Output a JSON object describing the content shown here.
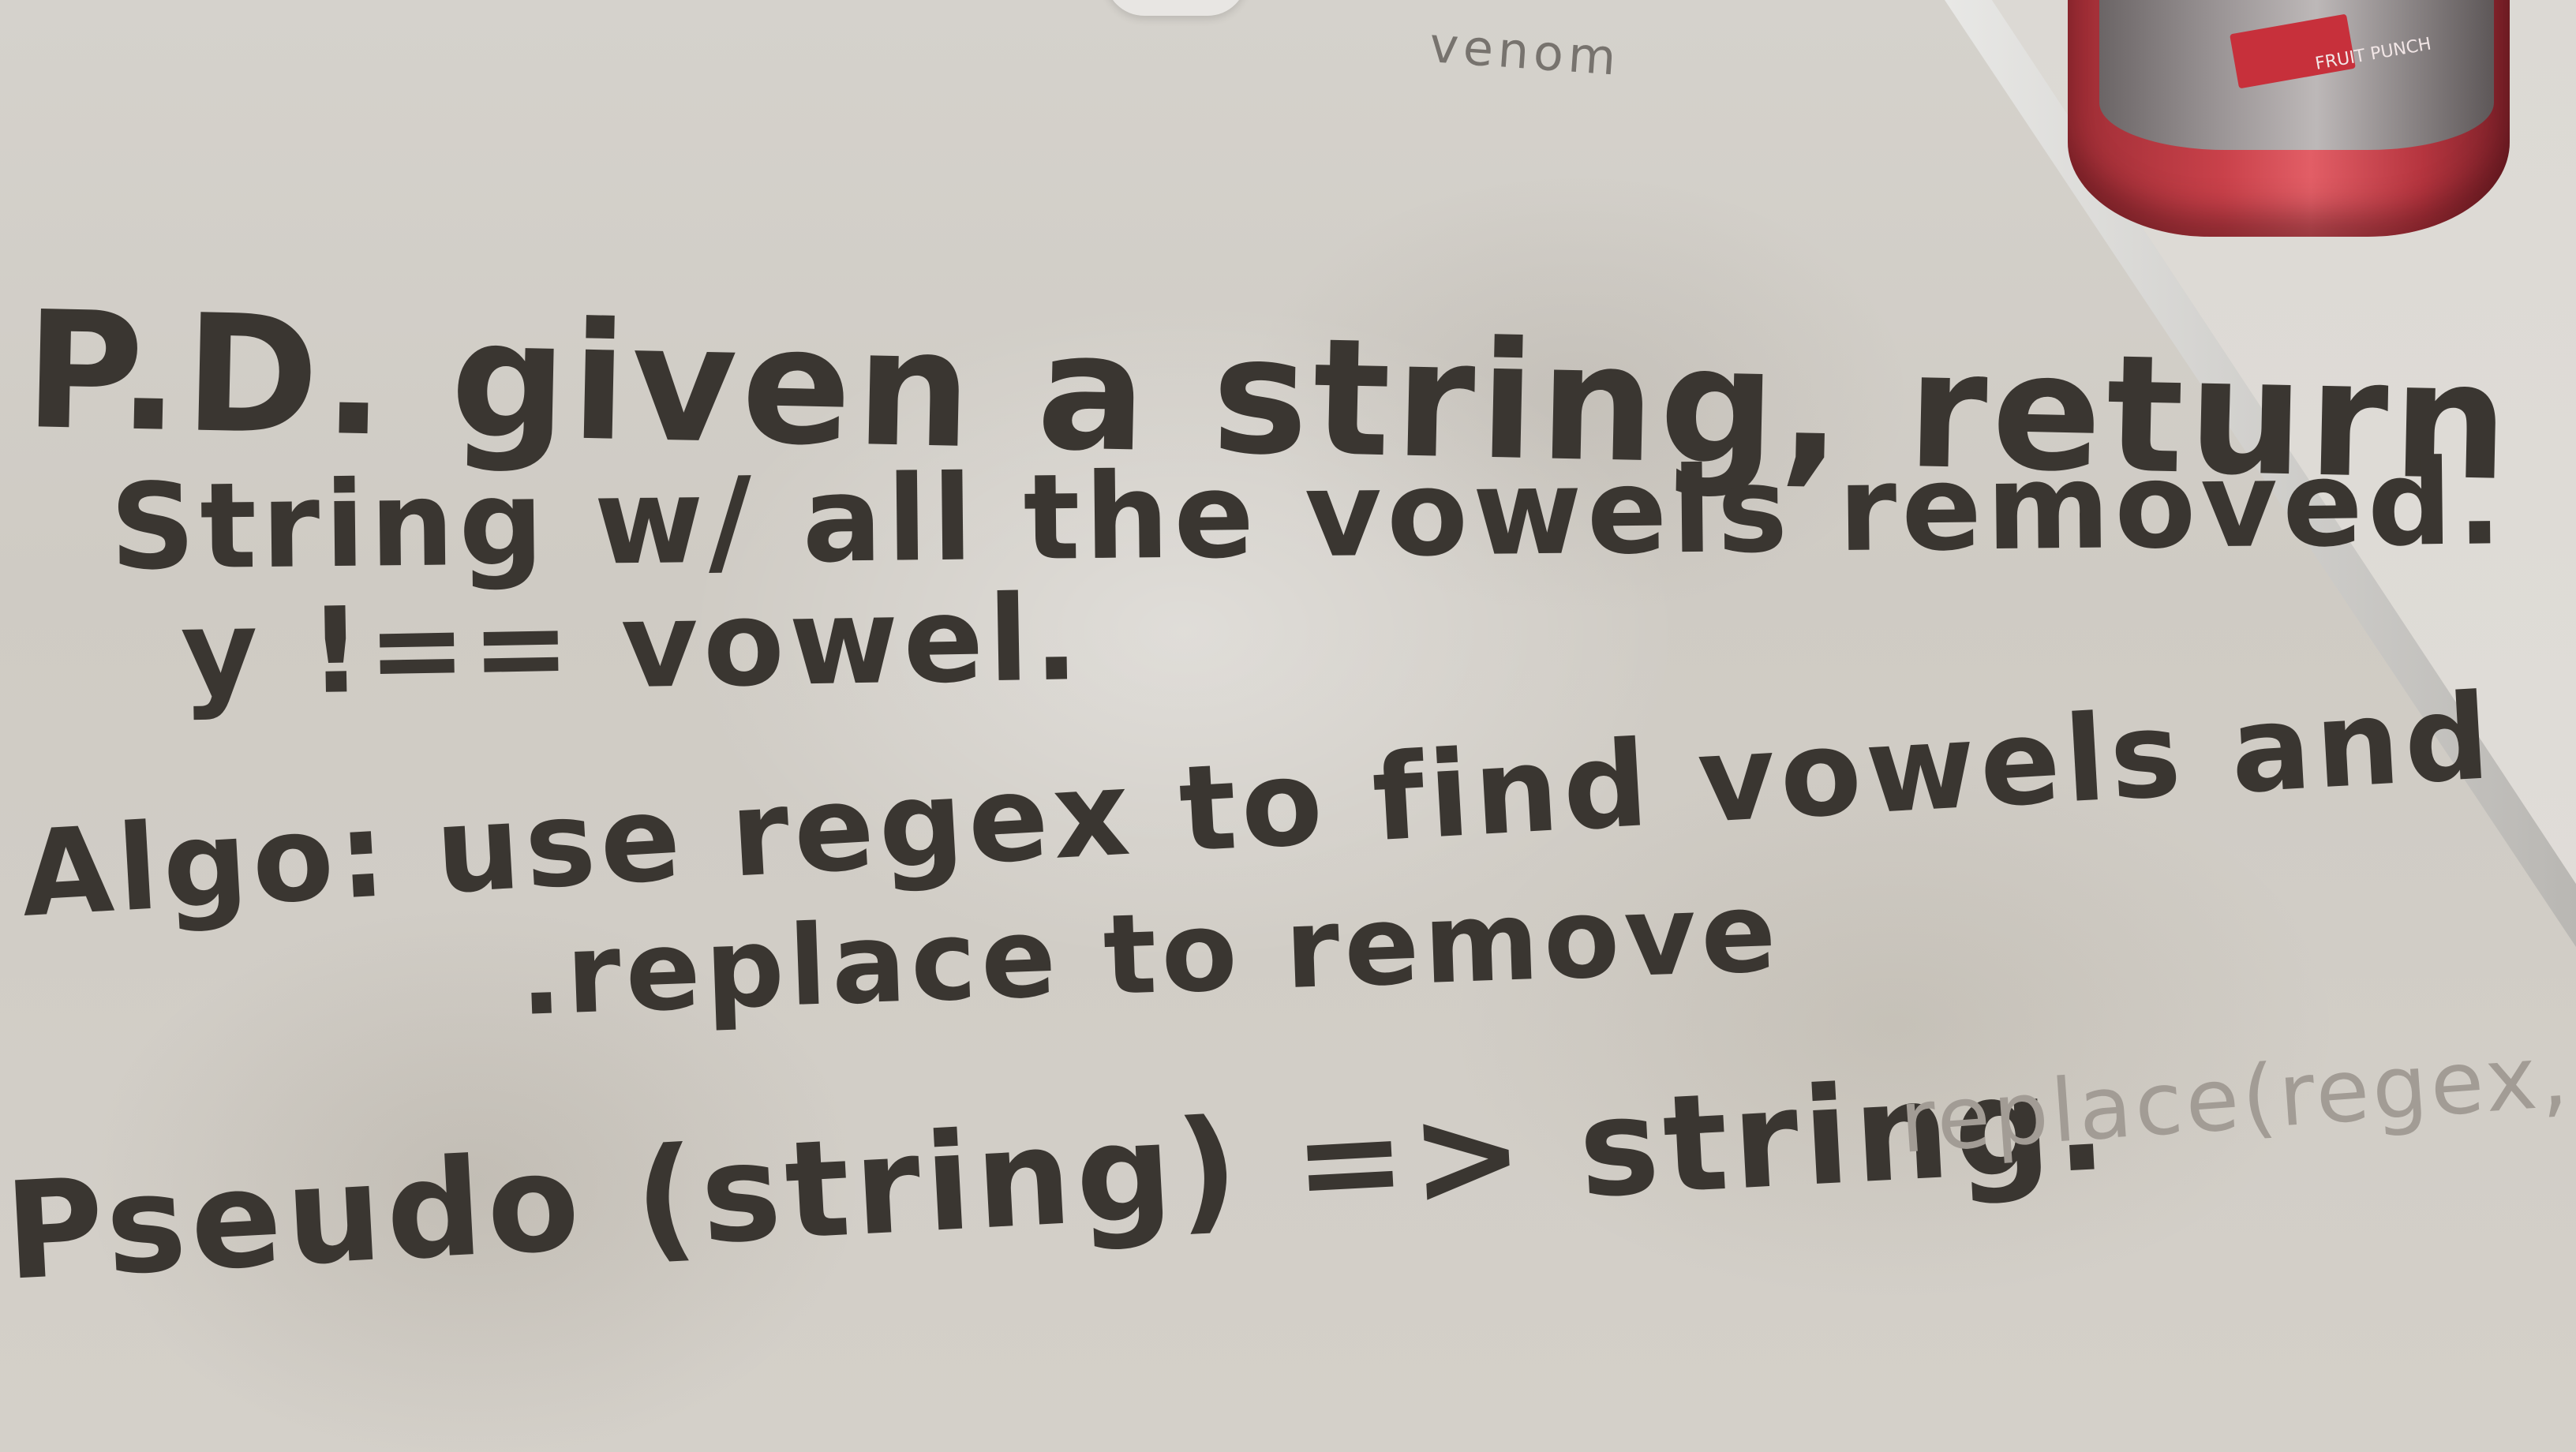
{
  "whiteboard": {
    "top_scribble": "venom",
    "lines": [
      "P.D. given a string, return the",
      "String w/ all the vowels removed.",
      "y !== vowel.",
      "Algo: use regex to find vowels and",
      ".replace to remove",
      "Pseudo (string) => string."
    ],
    "faint_continuation": "replace(regex,\""
  },
  "bottle": {
    "label": "FRUIT PUNCH",
    "color": "#c9414a"
  },
  "colors": {
    "ink": "#3a3631",
    "board": "#d2cec8"
  }
}
